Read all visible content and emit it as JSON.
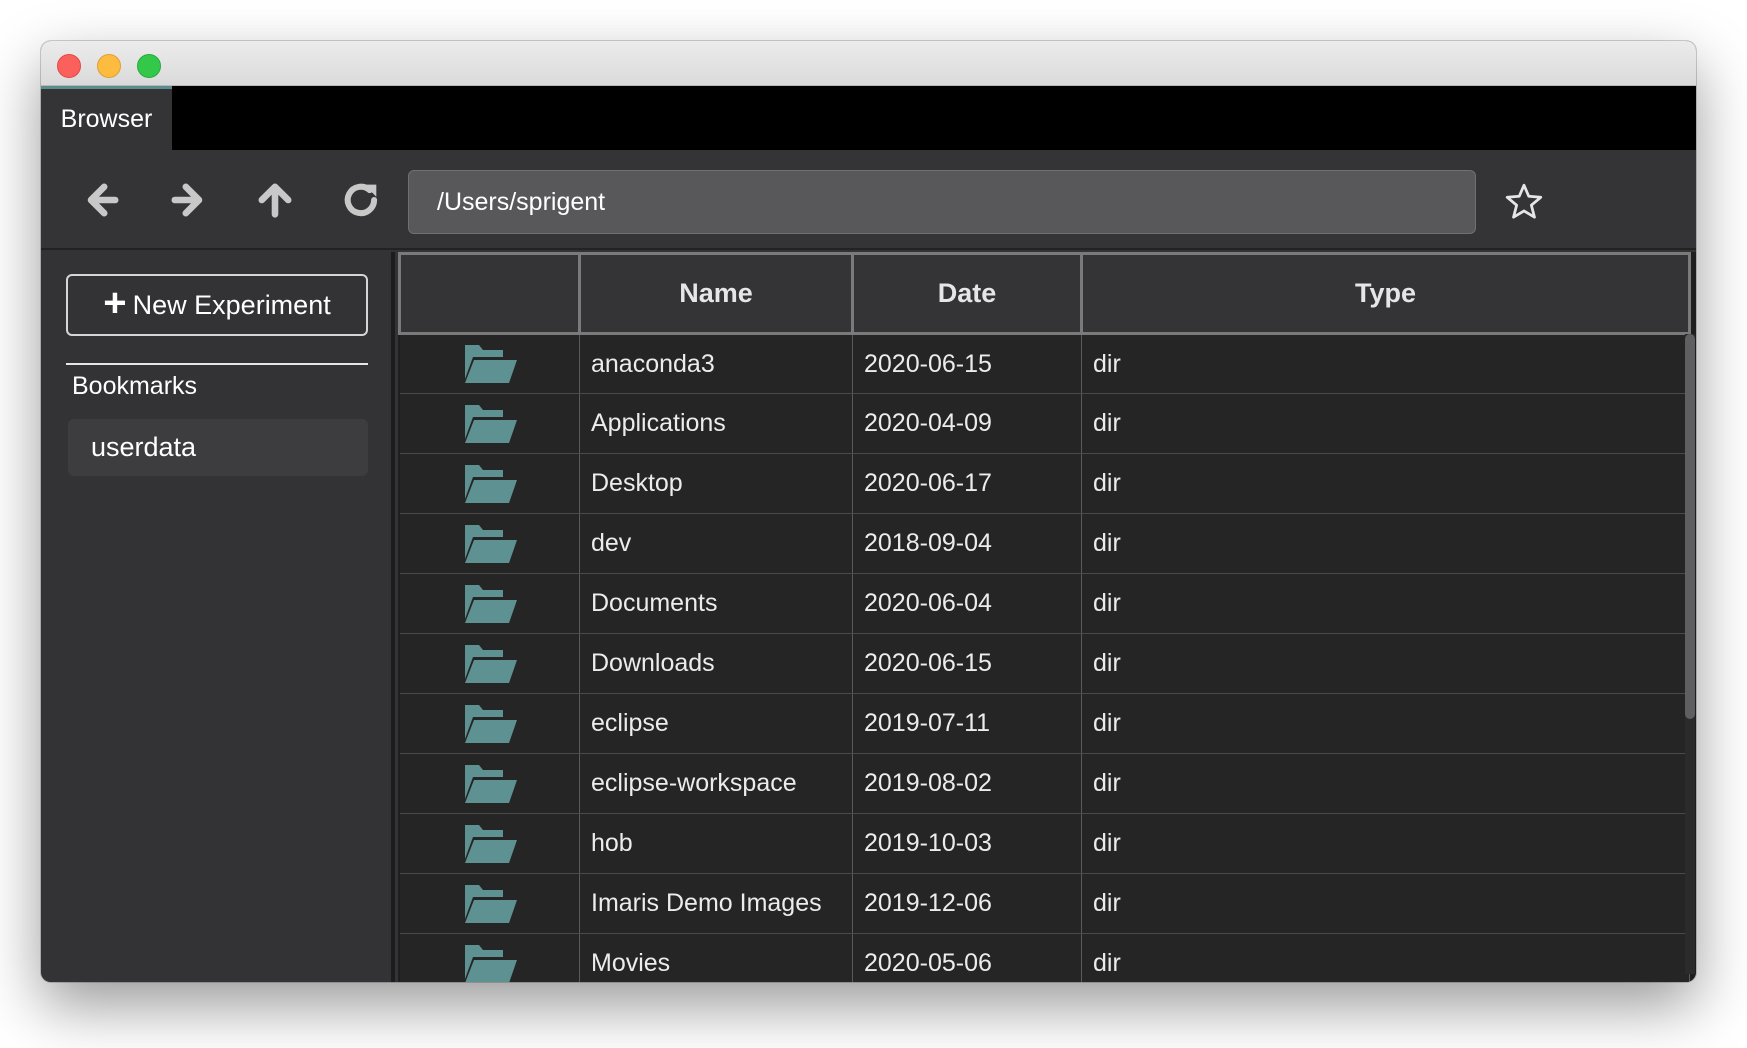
{
  "window": {
    "traffic_lights": [
      "close",
      "minimize",
      "maximize"
    ]
  },
  "tab": {
    "label": "Browser"
  },
  "toolbar": {
    "back_icon": "arrow-left-icon",
    "forward_icon": "arrow-right-icon",
    "up_icon": "arrow-up-icon",
    "refresh_icon": "refresh-icon",
    "address": "/Users/sprigent",
    "bookmark_icon": "star-icon"
  },
  "sidebar": {
    "new_experiment": {
      "icon": "plus-icon",
      "label": "New Experiment"
    },
    "bookmarks_title": "Bookmarks",
    "bookmarks": [
      {
        "label": "userdata"
      }
    ]
  },
  "table": {
    "columns": [
      "",
      "Name",
      "Date",
      "Type"
    ],
    "rows": [
      {
        "name": "anaconda3",
        "date": "2020-06-15",
        "type": "dir"
      },
      {
        "name": "Applications",
        "date": "2020-04-09",
        "type": "dir"
      },
      {
        "name": "Desktop",
        "date": "2020-06-17",
        "type": "dir"
      },
      {
        "name": "dev",
        "date": "2018-09-04",
        "type": "dir"
      },
      {
        "name": "Documents",
        "date": "2020-06-04",
        "type": "dir"
      },
      {
        "name": "Downloads",
        "date": "2020-06-15",
        "type": "dir"
      },
      {
        "name": "eclipse",
        "date": "2019-07-11",
        "type": "dir"
      },
      {
        "name": "eclipse-workspace",
        "date": "2019-08-02",
        "type": "dir"
      },
      {
        "name": "hob",
        "date": "2019-10-03",
        "type": "dir"
      },
      {
        "name": "Imaris Demo Images",
        "date": "2019-12-06",
        "type": "dir"
      },
      {
        "name": "Movies",
        "date": "2020-05-06",
        "type": "dir"
      }
    ]
  },
  "colors": {
    "folder": "#5e9191",
    "tab_accent": "#5a8d8d",
    "background": "#333335",
    "row_background": "#252525"
  }
}
